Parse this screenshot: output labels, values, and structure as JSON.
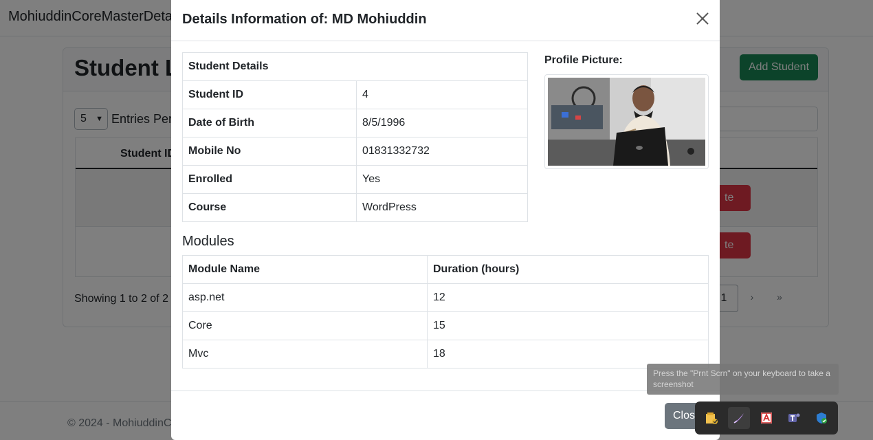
{
  "background": {
    "brand": "MohiuddinCoreMasterDeta",
    "card_title": "Student Li",
    "add_button": "Add Student",
    "entries_value": "5",
    "entries_label": "Entries Per",
    "column_header": "Student ID",
    "delete_label": "te",
    "showing_text": "Showing 1 to 2 of 2",
    "pagination": {
      "current": "1",
      "next": "›",
      "last": "»"
    },
    "footer_text": "© 2024 - MohiuddinC"
  },
  "modal": {
    "title_prefix": "Details Information of: ",
    "title_name": "MD Mohiuddin",
    "details_header": "Student Details",
    "details": [
      {
        "label": "Student ID",
        "value": "4"
      },
      {
        "label": "Date of Birth",
        "value": "8/5/1996"
      },
      {
        "label": "Mobile No",
        "value": "01831332732"
      },
      {
        "label": "Enrolled",
        "value": "Yes"
      },
      {
        "label": "Course",
        "value": "WordPress"
      }
    ],
    "profile_label": "Profile Picture:",
    "modules_title": "Modules",
    "modules_columns": [
      "Module Name",
      "Duration (hours)"
    ],
    "modules": [
      {
        "name": "asp.net",
        "duration": "12"
      },
      {
        "name": "Core",
        "duration": "15"
      },
      {
        "name": "Mvc",
        "duration": "18"
      }
    ],
    "close_button": "Clos"
  },
  "overlay": {
    "tooltip": "Press the \"Prnt Scrn\" on your keyboard to take a screenshot",
    "tray_icons": [
      "file-explorer-icon",
      "pen-icon",
      "pdf-icon",
      "teams-icon",
      "security-icon"
    ]
  },
  "colors": {
    "success": "#198754",
    "danger": "#dc3545",
    "secondary": "#6c757d",
    "border": "#dee2e6"
  }
}
